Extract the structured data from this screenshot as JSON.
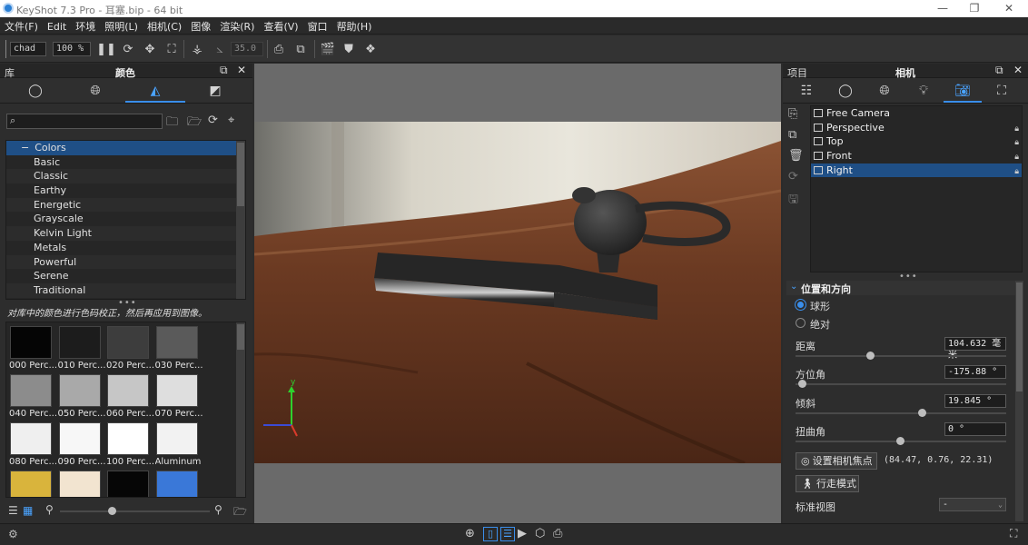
{
  "window": {
    "title": "KeyShot 7.3 Pro - 耳塞.bip - 64 bit",
    "minimize_glyph": "—",
    "restore_glyph": "❐",
    "close_glyph": "✕"
  },
  "menu": [
    "文件(F)",
    "Edit",
    "环境",
    "照明(L)",
    "相机(C)",
    "图像",
    "渲染(R)",
    "查看(V)",
    "窗口",
    "帮助(H)"
  ],
  "toolbar": {
    "workspace_value": "chad",
    "zoom_value": "100 %",
    "fov_value": "35.0"
  },
  "left_panel": {
    "title_left": "库",
    "title_center": "颜色",
    "tabs": [
      "material-tab",
      "environment-tab",
      "colors-tab",
      "texture-tab"
    ],
    "active_tab": 2,
    "search_placeholder": "",
    "tree": {
      "root": "Colors",
      "items": [
        "Basic",
        "Classic",
        "Earthy",
        "Energetic",
        "Grayscale",
        "Kelvin Light",
        "Metals",
        "Powerful",
        "Serene",
        "Traditional"
      ]
    },
    "hint": "对库中的颜色进行色码校正，然后再应用到图像。",
    "swatches": [
      {
        "label": "000 Perc...",
        "color": "#050505"
      },
      {
        "label": "010 Perc...",
        "color": "#1c1c1c"
      },
      {
        "label": "020 Perc...",
        "color": "#3d3d3d"
      },
      {
        "label": "030 Perc...",
        "color": "#5a5a5a"
      },
      {
        "label": "040 Perc...",
        "color": "#8c8c8c"
      },
      {
        "label": "050 Perc...",
        "color": "#a9a9a9"
      },
      {
        "label": "060 Perc...",
        "color": "#c6c6c6"
      },
      {
        "label": "070 Perc...",
        "color": "#dedede"
      },
      {
        "label": "080 Perc...",
        "color": "#efefef"
      },
      {
        "label": "090 Perc...",
        "color": "#f7f7f7"
      },
      {
        "label": "100 Perc...",
        "color": "#ffffff"
      },
      {
        "label": "Aluminum",
        "color": "#f2f2f2"
      },
      {
        "label": "",
        "color": "#d9b43c"
      },
      {
        "label": "",
        "color": "#f2e4d0"
      },
      {
        "label": "",
        "color": "#060606"
      },
      {
        "label": "",
        "color": "#3a78d8"
      }
    ]
  },
  "right_panel": {
    "title_left": "项目",
    "title_center": "相机",
    "tabs": [
      "scene-tab",
      "material-tab",
      "environment-tab",
      "lighting-tab",
      "camera-tab",
      "image-tab"
    ],
    "active_tab": 4,
    "cameras": [
      {
        "name": "Free Camera",
        "locked": false
      },
      {
        "name": "Perspective",
        "locked": true
      },
      {
        "name": "Top",
        "locked": true
      },
      {
        "name": "Front",
        "locked": true
      },
      {
        "name": "Right",
        "locked": true
      }
    ],
    "selected_camera": 4,
    "section_title": "位置和方向",
    "radio_spherical": "球形",
    "radio_absolute": "绝对",
    "radio_selected": "spherical",
    "props": {
      "distance_label": "距离",
      "distance_value": "104.632 毫米",
      "azimuth_label": "方位角",
      "azimuth_value": "-175.88 °",
      "inclination_label": "倾斜",
      "inclination_value": "19.845 °",
      "twist_label": "扭曲角",
      "twist_value": "0 °"
    },
    "set_focus_label": "设置相机焦点",
    "focus_coords": "(84.47, 0.76, 22.31)",
    "walk_mode_label": "行走模式",
    "standard_view_label": "标准视图",
    "standard_view_value": "-"
  },
  "viewport": {
    "axis_labels": {
      "y": "y"
    },
    "colors": {
      "sofa": "#6b3a22",
      "device": "#2c2c2c",
      "background": "#6a6a6a"
    }
  },
  "colors": {
    "accent": "#3a8eea",
    "selection": "#1f4f86",
    "panel_bg": "#2d2d2d"
  }
}
